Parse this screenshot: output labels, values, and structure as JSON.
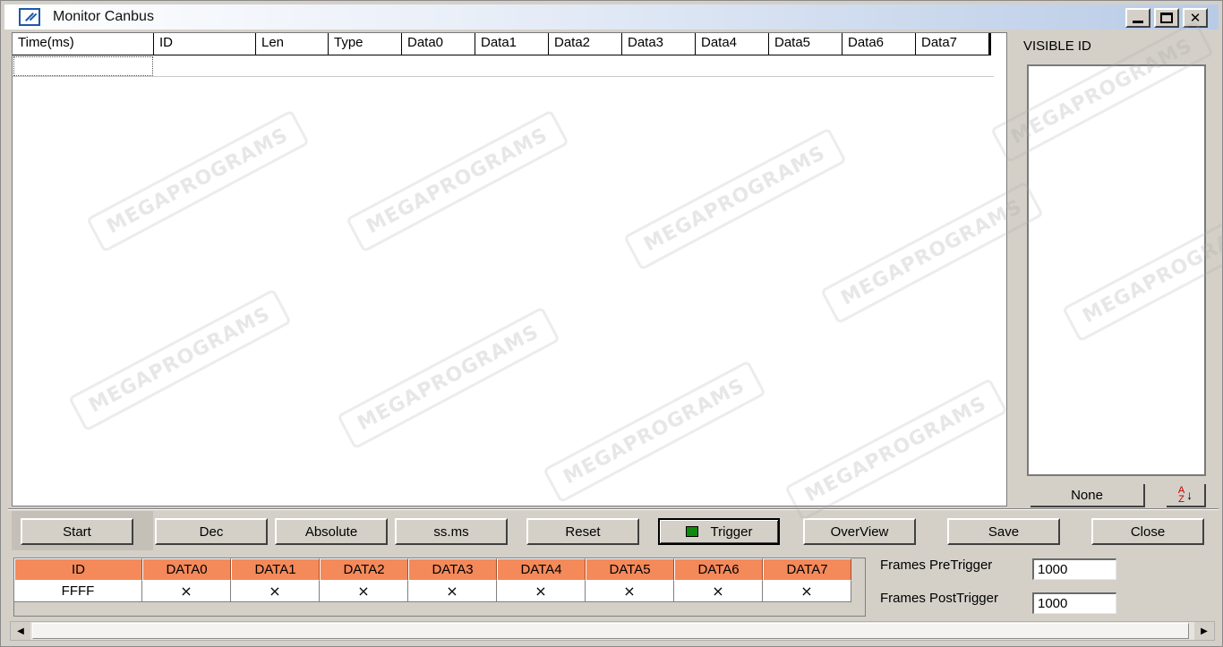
{
  "window": {
    "title": "Monitor Canbus",
    "controls": [
      "minimize",
      "maximize",
      "close"
    ]
  },
  "grid": {
    "columns": [
      "Time(ms)",
      "ID",
      "Len",
      "Type",
      "Data0",
      "Data1",
      "Data2",
      "Data3",
      "Data4",
      "Data5",
      "Data6",
      "Data7"
    ],
    "rows": []
  },
  "visible_panel": {
    "title": "VISIBLE ID",
    "none_label": "None",
    "sort_icon": "sort-az-icon",
    "sort_glyph_top": "A",
    "sort_glyph_bottom": "Z",
    "sort_arrow": "↓"
  },
  "toolbar": {
    "start": "Start",
    "dec": "Dec",
    "absolute": "Absolute",
    "ssms": "ss.ms",
    "reset": "Reset",
    "trigger": "Trigger",
    "overview": "OverView",
    "save": "Save",
    "close": "Close"
  },
  "trigger_table": {
    "headers": [
      "ID",
      "DATA0",
      "DATA1",
      "DATA2",
      "DATA3",
      "DATA4",
      "DATA5",
      "DATA6",
      "DATA7"
    ],
    "row": [
      "FFFF",
      "×",
      "×",
      "×",
      "×",
      "×",
      "×",
      "×",
      "×"
    ],
    "header_color": "#f4895a"
  },
  "frames": {
    "pre_label": "Frames PreTrigger",
    "pre_value": "1000",
    "post_label": "Frames PostTrigger",
    "post_value": "1000"
  },
  "scrollbar": {
    "left_arrow": "◀",
    "right_arrow": "▶"
  },
  "watermark_text": "MEGAPROGRAMS",
  "colors": {
    "trigger_led": "#0e8a0e",
    "window_bg": "#d4d0c8"
  }
}
